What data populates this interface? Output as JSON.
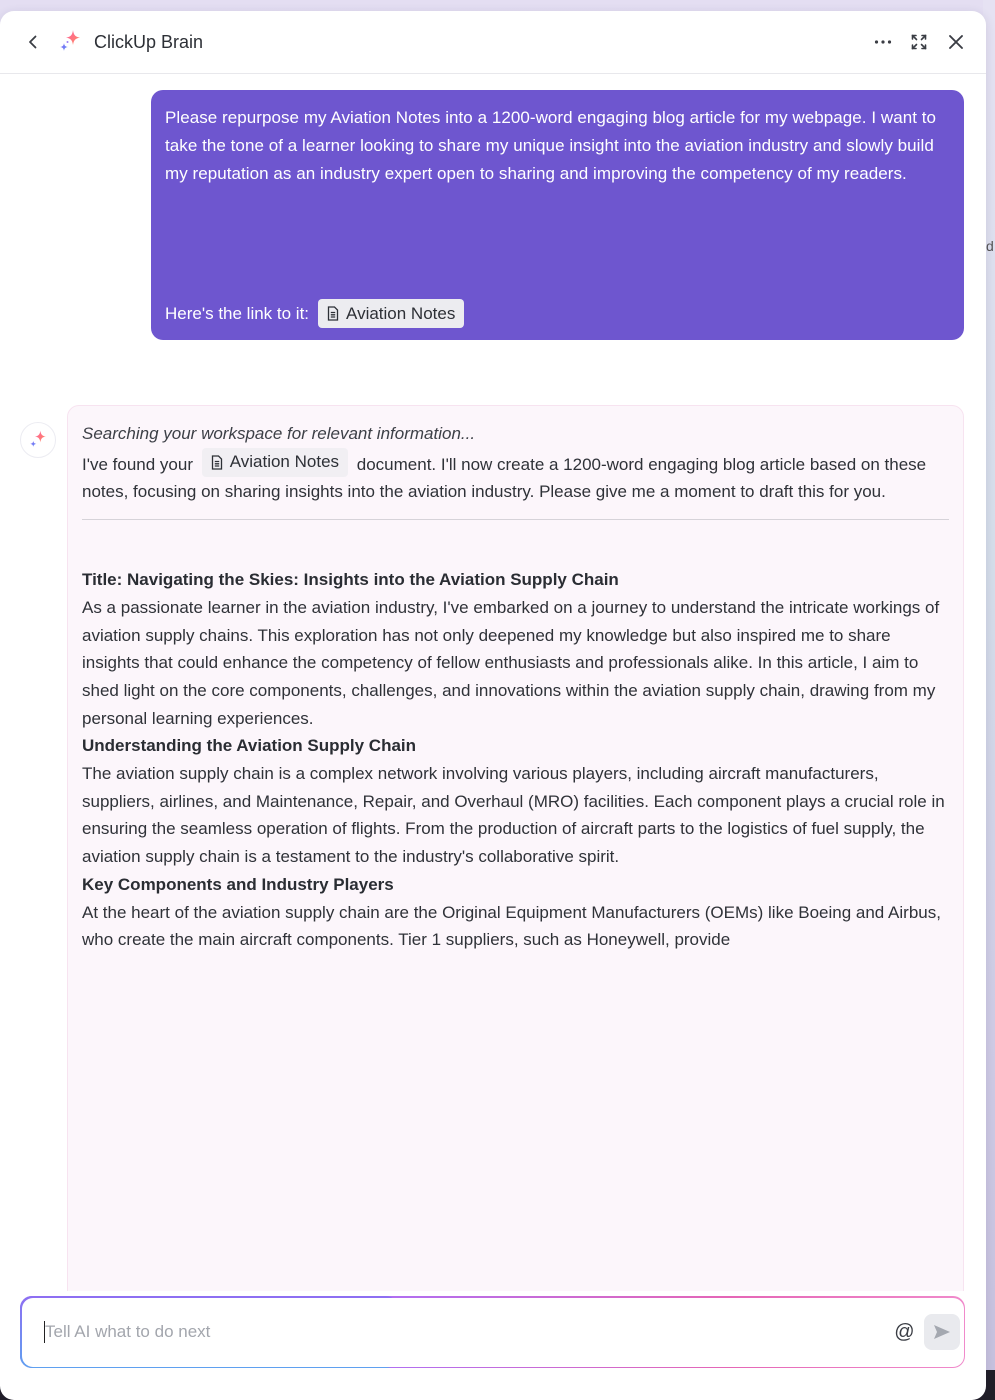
{
  "header": {
    "title": "ClickUp Brain",
    "back_icon": "chevron-left-icon",
    "logo_icon": "sparkle-icon",
    "more_icon": "ellipsis-icon",
    "expand_icon": "expand-icon",
    "close_icon": "close-icon"
  },
  "background": {
    "edge_letter": "d"
  },
  "user_message": {
    "text": "Please repurpose my Aviation Notes into a 1200-word engaging blog article for my webpage. I want to take the tone of a learner looking to share my unique insight into the aviation industry and slowly build my reputation as an industry expert open to sharing and improving the competency of my readers.",
    "link_prefix": "Here's the link to it:",
    "doc_chip": {
      "icon": "document-icon",
      "label": "Aviation Notes"
    }
  },
  "ai_message": {
    "avatar_icon": "sparkle-icon",
    "status": "Searching your workspace for relevant information...",
    "found_prefix": "I've found your",
    "doc_chip": {
      "icon": "document-icon",
      "label": "Aviation Notes"
    },
    "found_suffix": "document. I'll now create a 1200-word engaging blog article based on these notes, focusing on sharing insights into the aviation industry. Please give me a moment to draft this for you.",
    "article": {
      "title": "Title: Navigating the Skies: Insights into the Aviation Supply Chain",
      "intro": "As a passionate learner in the aviation industry, I've embarked on a journey to understand the intricate workings of aviation supply chains. This exploration has not only deepened my knowledge but also inspired me to share insights that could enhance the competency of fellow enthusiasts and professionals alike. In this article, I aim to shed light on the core components, challenges, and innovations within the aviation supply chain, drawing from my personal learning experiences.",
      "section1_heading": "Understanding the Aviation Supply Chain",
      "section1_body": "The aviation supply chain is a complex network involving various players, including aircraft manufacturers, suppliers, airlines, and Maintenance, Repair, and Overhaul (MRO) facilities. Each component plays a crucial role in ensuring the seamless operation of flights. From the production of aircraft parts to the logistics of fuel supply, the aviation supply chain is a testament to the industry's collaborative spirit.",
      "section2_heading": "Key Components and Industry Players",
      "section2_body": "At the heart of the aviation supply chain are the Original Equipment Manufacturers (OEMs) like Boeing and Airbus, who create the main aircraft components. Tier 1 suppliers, such as Honeywell, provide"
    }
  },
  "composer": {
    "placeholder": "Tell AI what to do next",
    "value": "",
    "mention_icon": "at-icon",
    "send_icon": "send-icon"
  },
  "colors": {
    "user_bubble": "#6e56cf",
    "ai_bubble": "#fcf6fb",
    "accent_pink": "#f0589a",
    "accent_purple": "#7b6cf2"
  }
}
